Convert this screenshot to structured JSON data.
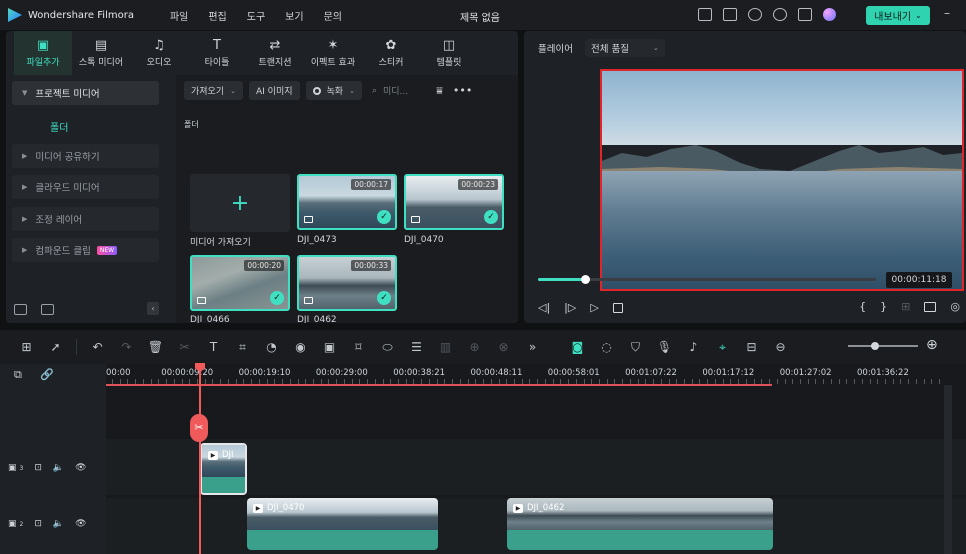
{
  "app": {
    "name": "Wondershare Filmora",
    "doc_title": "제목 없음",
    "export_label": "내보내기"
  },
  "menu": [
    "파일",
    "편집",
    "도구",
    "보기",
    "문의"
  ],
  "media_tabs": [
    {
      "label": "파일추가",
      "icon": "media-folder-icon"
    },
    {
      "label": "스톡 미디어",
      "icon": "stock-media-icon"
    },
    {
      "label": "오디오",
      "icon": "music-note-icon"
    },
    {
      "label": "타이틀",
      "icon": "text-t-icon"
    },
    {
      "label": "트랜지션",
      "icon": "transition-icon"
    },
    {
      "label": "이펙트 효과",
      "icon": "effects-sparkle-icon"
    },
    {
      "label": "스티커",
      "icon": "sticker-icon"
    },
    {
      "label": "템플릿",
      "icon": "template-icon"
    }
  ],
  "sidebar": {
    "project_media": "프로젝트 미디어",
    "folder": "폴더",
    "items": [
      "미디어 공유하기",
      "클라우드 미디어",
      "조정 레이어",
      "컴파운드 클립"
    ],
    "new_badge": "NEW"
  },
  "media_toolbar": {
    "import": "가져오기",
    "ai_image": "AI 이미지",
    "record": "녹화",
    "search_placeholder": "미디..."
  },
  "media": {
    "folder_label": "폴더",
    "import_label": "미디어 가져오기",
    "clips": [
      {
        "name": "DJI_0473",
        "duration": "00:00:17"
      },
      {
        "name": "DJI_0470",
        "duration": "00:00:23"
      },
      {
        "name": "DJI_0466",
        "duration": "00:00:20"
      },
      {
        "name": "DJI_0462",
        "duration": "00:00:33"
      }
    ]
  },
  "player": {
    "label": "플레이어",
    "quality": "전체 품질",
    "timecode": "00:00:11:18",
    "progress": 0.14
  },
  "timeline": {
    "ruler": [
      "00:00",
      "00:00:09:20",
      "00:00:19:10",
      "00:00:29:00",
      "00:00:38:21",
      "00:00:48:11",
      "00:00:58:01",
      "00:01:07:22",
      "00:01:17:12",
      "00:01:27:02",
      "00:01:36:22"
    ],
    "tracks": [
      {
        "number": "3",
        "clips": [
          {
            "name": "DJI"
          }
        ]
      },
      {
        "number": "2",
        "clips": [
          {
            "name": "DJI_0470"
          },
          {
            "name": "DJI_0462"
          }
        ]
      }
    ]
  },
  "colors": {
    "accent": "#3fe0c2",
    "playhead": "#f05a5a",
    "preview_border": "#e0262a"
  }
}
